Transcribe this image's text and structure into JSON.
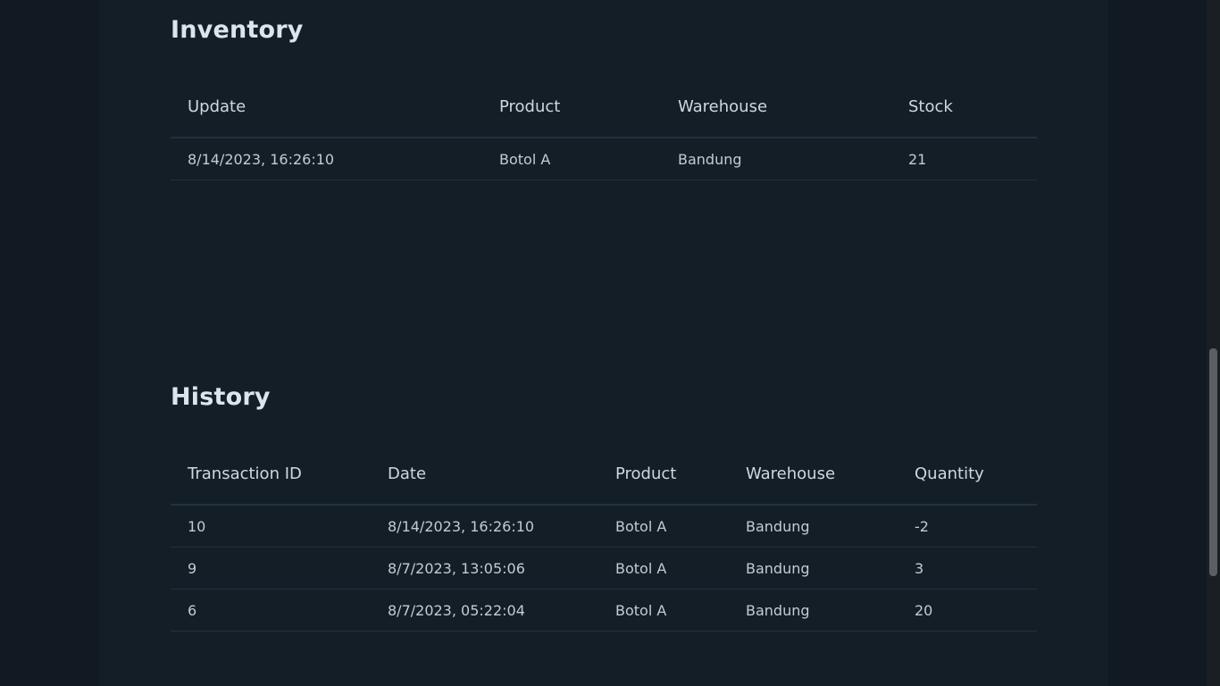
{
  "inventory": {
    "title": "Inventory",
    "columns": [
      "Update",
      "Product",
      "Warehouse",
      "Stock"
    ],
    "rows": [
      [
        "8/14/2023, 16:26:10",
        "Botol A",
        "Bandung",
        "21"
      ]
    ]
  },
  "history": {
    "title": "History",
    "columns": [
      "Transaction ID",
      "Date",
      "Product",
      "Warehouse",
      "Quantity"
    ],
    "rows": [
      [
        "10",
        "8/14/2023, 16:26:10",
        "Botol A",
        "Bandung",
        "-2"
      ],
      [
        "9",
        "8/7/2023, 13:05:06",
        "Botol A",
        "Bandung",
        "3"
      ],
      [
        "6",
        "8/7/2023, 05:22:04",
        "Botol A",
        "Bandung",
        "20"
      ]
    ]
  },
  "colors": {
    "background": "#111a22",
    "panel": "#141e27",
    "text": "#c8d1da"
  }
}
